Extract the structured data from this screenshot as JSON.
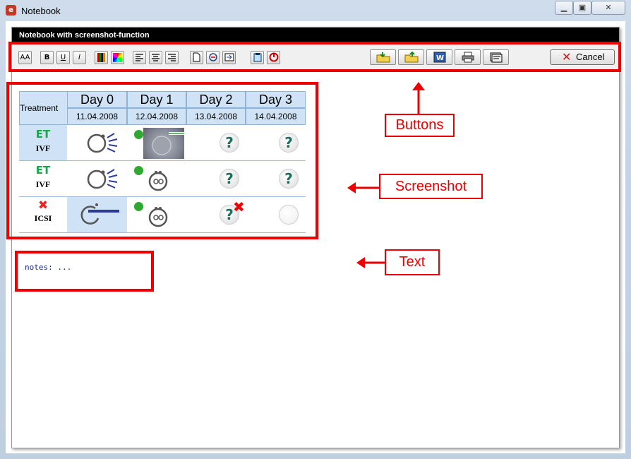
{
  "window": {
    "title": "Notebook"
  },
  "panel": {
    "header": "Notebook with screenshot-function"
  },
  "toolbar": {
    "font_label": "AA",
    "bold_label": "B",
    "underline_label": "U",
    "italic_label": "I",
    "cancel_label": "Cancel"
  },
  "table": {
    "treatment_header": "Treatment",
    "days": [
      "Day 0",
      "Day 1",
      "Day 2",
      "Day 3"
    ],
    "dates": [
      "11.04.2008",
      "12.04.2008",
      "13.04.2008",
      "14.04.2008"
    ],
    "rows": [
      {
        "status": "ET",
        "procedure": "IVF"
      },
      {
        "status": "ET",
        "procedure": "IVF"
      },
      {
        "status": "✖",
        "procedure": "ICSI"
      }
    ],
    "unknown_glyph": "?"
  },
  "notes": {
    "text": "notes: ..."
  },
  "callouts": {
    "buttons": "Buttons",
    "screenshot": "Screenshot",
    "text": "Text"
  },
  "colors": {
    "annotation_red": "#e00000",
    "header_blue": "#cfe2f6",
    "status_green": "#1aa64a"
  }
}
